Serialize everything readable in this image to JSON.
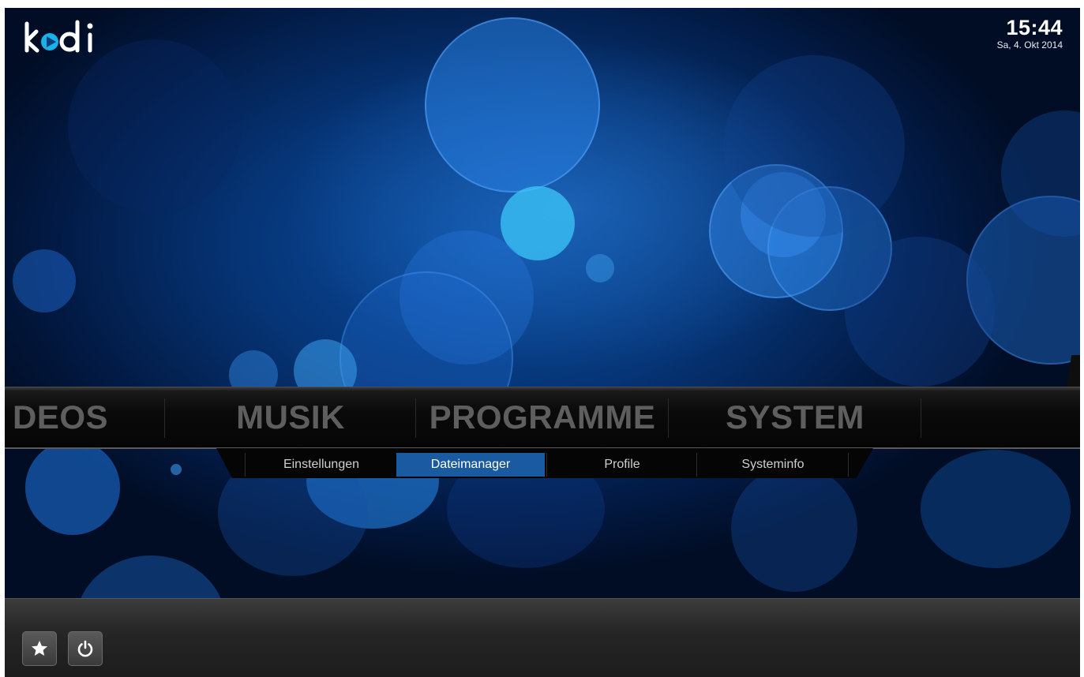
{
  "app": {
    "name": "kodi"
  },
  "clock": {
    "time": "15:44",
    "date": "Sa, 4. Okt 2014"
  },
  "main_menu": {
    "items": [
      {
        "label": "DEOS",
        "selected": false
      },
      {
        "label": "MUSIK",
        "selected": false
      },
      {
        "label": "PROGRAMME",
        "selected": false
      },
      {
        "label": "SYSTEM",
        "selected": true
      }
    ]
  },
  "sub_menu": {
    "items": [
      {
        "label": "Einstellungen",
        "active": false
      },
      {
        "label": "Dateimanager",
        "active": true
      },
      {
        "label": "Profile",
        "active": false
      },
      {
        "label": "Systeminfo",
        "active": false
      }
    ]
  },
  "bottom_bar": {
    "buttons": [
      {
        "icon": "star-icon"
      },
      {
        "icon": "power-icon"
      }
    ]
  },
  "colors": {
    "accent": "#1a5aa0",
    "logo_blue": "#17b2e7",
    "background_blue": "#0b4da0",
    "menu_inactive_text": "#5e5e5e"
  }
}
